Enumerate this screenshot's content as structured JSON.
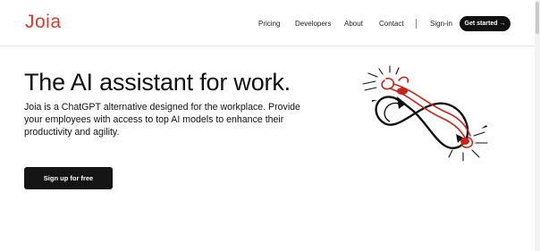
{
  "brand": {
    "name": "Joia",
    "color": "#d63b2f"
  },
  "nav": {
    "links": [
      {
        "label": "Pricing"
      },
      {
        "label": "Developers"
      },
      {
        "label": "About"
      },
      {
        "label": "Contact"
      }
    ],
    "signin": "Sign-in",
    "cta": "Get started →"
  },
  "hero": {
    "title": "The AI assistant for work.",
    "subtitle": "Joia is a ChatGPT alternative designed for the workplace. Provide your employees with access to top AI models to enhance their productivity and agility.",
    "button": "Sign up for free",
    "illustration": "infinity-doodle-illustration"
  },
  "colors": {
    "accent": "#d63b2f",
    "dark": "#111111",
    "background": "#ffffff"
  }
}
